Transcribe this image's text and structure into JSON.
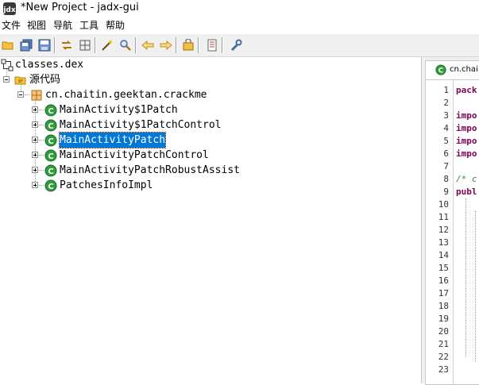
{
  "window": {
    "title": "*New Project - jadx-gui"
  },
  "menu": {
    "items": [
      {
        "label": "文件"
      },
      {
        "label": "视图"
      },
      {
        "label": "导航"
      },
      {
        "label": "工具"
      },
      {
        "label": "帮助"
      }
    ]
  },
  "toolbar": {
    "icons": [
      "open-folder-icon",
      "save-all-icon",
      "save-icon",
      "sync-icon",
      "flatten-packages-icon",
      "magic-wand-icon",
      "search-icon",
      "back-arrow-icon",
      "forward-arrow-icon",
      "deobfuscation-icon",
      "log-icon",
      "preferences-wrench-icon"
    ]
  },
  "tree": {
    "root": {
      "label": "classes.dex"
    },
    "source": {
      "label": "源代码"
    },
    "package": {
      "label": "cn.chaitin.geektan.crackme"
    },
    "classes": [
      {
        "label": "MainActivity$1Patch",
        "selected": false
      },
      {
        "label": "MainActivity$1PatchControl",
        "selected": false
      },
      {
        "label": "MainActivityPatch",
        "selected": true
      },
      {
        "label": "MainActivityPatchControl",
        "selected": false
      },
      {
        "label": "MainActivityPatchRobustAssist",
        "selected": false
      },
      {
        "label": "PatchesInfoImpl",
        "selected": false
      }
    ]
  },
  "editor": {
    "tab_label": "cn.chai",
    "line_numbers": [
      "1",
      "2",
      "3",
      "4",
      "5",
      "6",
      "7",
      "8",
      "9",
      "10",
      "11",
      "12",
      "13",
      "14",
      "15",
      "16",
      "17",
      "18",
      "19",
      "20",
      "21",
      "22",
      "23"
    ],
    "code_lines": [
      {
        "line": 1,
        "text": "pack"
      },
      {
        "line": 3,
        "text": "impo"
      },
      {
        "line": 4,
        "text": "impo"
      },
      {
        "line": 5,
        "text": "impo"
      },
      {
        "line": 6,
        "text": "impo"
      },
      {
        "line": 8,
        "text": "/* c"
      },
      {
        "line": 9,
        "text": "publ"
      }
    ]
  },
  "colors": {
    "selection": "#0078d7",
    "class_icon": "#2e9e3a",
    "keyword": "#7f0055",
    "comment": "#3f7f5f"
  }
}
